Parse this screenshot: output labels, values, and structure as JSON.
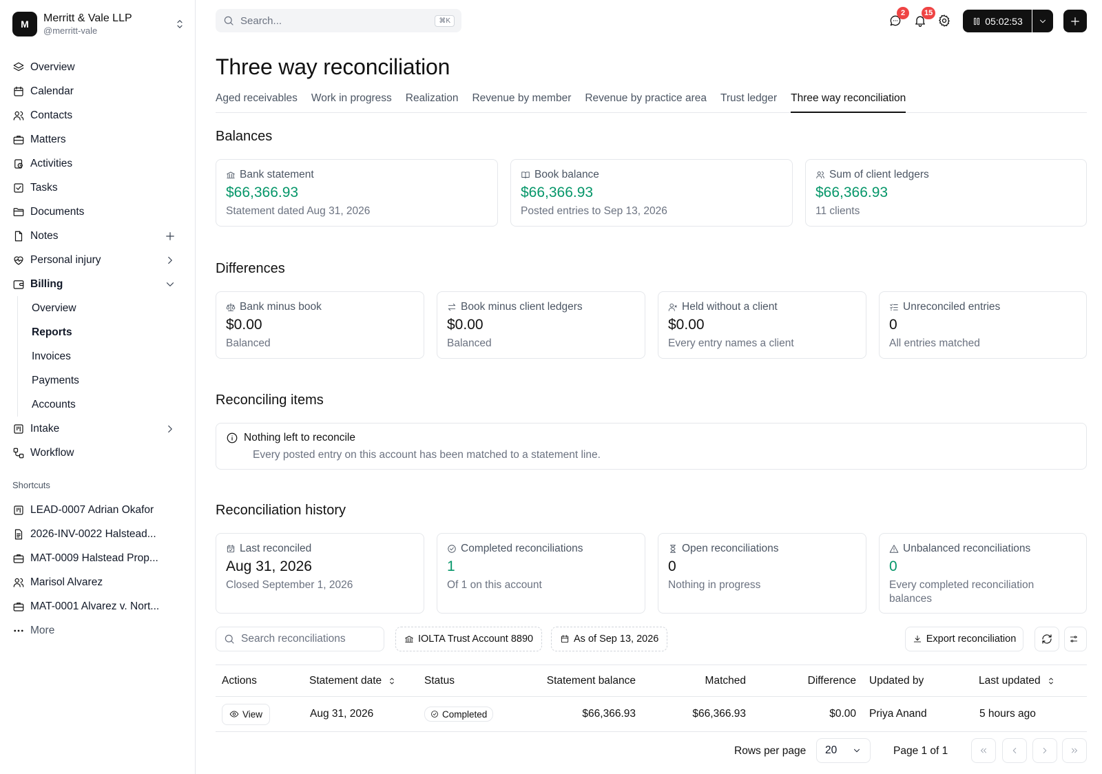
{
  "workspace": {
    "initial": "M",
    "name": "Merritt & Vale LLP",
    "handle": "@merritt-vale"
  },
  "nav": {
    "overview": "Overview",
    "calendar": "Calendar",
    "contacts": "Contacts",
    "matters": "Matters",
    "activities": "Activities",
    "tasks": "Tasks",
    "documents": "Documents",
    "notes": "Notes",
    "personal_injury": "Personal injury",
    "billing": "Billing",
    "billing_sub": [
      "Overview",
      "Reports",
      "Invoices",
      "Payments",
      "Accounts"
    ],
    "intake": "Intake",
    "workflow": "Workflow"
  },
  "shortcuts": {
    "heading": "Shortcuts",
    "items": [
      "LEAD-0007 Adrian Okafor",
      "2026-INV-0022 Halstead...",
      "MAT-0009 Halstead Prop...",
      "Marisol Alvarez",
      "MAT-0001 Alvarez v. Nort..."
    ],
    "more": "More"
  },
  "topbar": {
    "search_placeholder": "Search...",
    "shortcut": "⌘K",
    "messages_count": "2",
    "notifications_count": "15",
    "timer": "05:02:53"
  },
  "page": {
    "title": "Three way reconciliation",
    "tabs": [
      "Aged receivables",
      "Work in progress",
      "Realization",
      "Revenue by member",
      "Revenue by practice area",
      "Trust ledger",
      "Three way reconciliation"
    ],
    "active_tab": "Three way reconciliation"
  },
  "balances": {
    "heading": "Balances",
    "cards": [
      {
        "label": "Bank statement",
        "value": "$66,366.93",
        "sub": "Statement dated Aug 31, 2026"
      },
      {
        "label": "Book balance",
        "value": "$66,366.93",
        "sub": "Posted entries to Sep 13, 2026"
      },
      {
        "label": "Sum of client ledgers",
        "value": "$66,366.93",
        "sub": "11 clients"
      }
    ]
  },
  "differences": {
    "heading": "Differences",
    "cards": [
      {
        "label": "Bank minus book",
        "value": "$0.00",
        "sub": "Balanced"
      },
      {
        "label": "Book minus client ledgers",
        "value": "$0.00",
        "sub": "Balanced"
      },
      {
        "label": "Held without a client",
        "value": "$0.00",
        "sub": "Every entry names a client"
      },
      {
        "label": "Unreconciled entries",
        "value": "0",
        "sub": "All entries matched"
      }
    ]
  },
  "reconciling": {
    "heading": "Reconciling items",
    "title": "Nothing left to reconcile",
    "desc": "Every posted entry on this account has been matched to a statement line."
  },
  "history": {
    "heading": "Reconciliation history",
    "cards": [
      {
        "label": "Last reconciled",
        "value": "Aug 31, 2026",
        "sub": "Closed September 1, 2026"
      },
      {
        "label": "Completed reconciliations",
        "value": "1",
        "sub": "Of 1 on this account"
      },
      {
        "label": "Open reconciliations",
        "value": "0",
        "sub": "Nothing in progress"
      },
      {
        "label": "Unbalanced reconciliations",
        "value": "0",
        "sub": "Every completed reconciliation balances"
      }
    ]
  },
  "toolbar": {
    "search_placeholder": "Search reconciliations",
    "account": "IOLTA Trust Account 8890",
    "as_of": "As of Sep 13, 2026",
    "export": "Export reconciliation"
  },
  "table": {
    "columns": [
      "Actions",
      "Statement date",
      "Status",
      "Statement balance",
      "Matched",
      "Difference",
      "Updated by",
      "Last updated"
    ],
    "rows": [
      {
        "action": "View",
        "statement_date": "Aug 31, 2026",
        "status": "Completed",
        "statement_balance": "$66,366.93",
        "matched": "$66,366.93",
        "difference": "$0.00",
        "updated_by": "Priya Anand",
        "last_updated": "5 hours ago"
      }
    ]
  },
  "pagination": {
    "rows_per_page_label": "Rows per page",
    "rows_per_page": "20",
    "page_label": "Page 1 of 1"
  },
  "colors": {
    "accent_green": "#059669",
    "badge_red": "#ef4444",
    "dark": "#111111"
  }
}
